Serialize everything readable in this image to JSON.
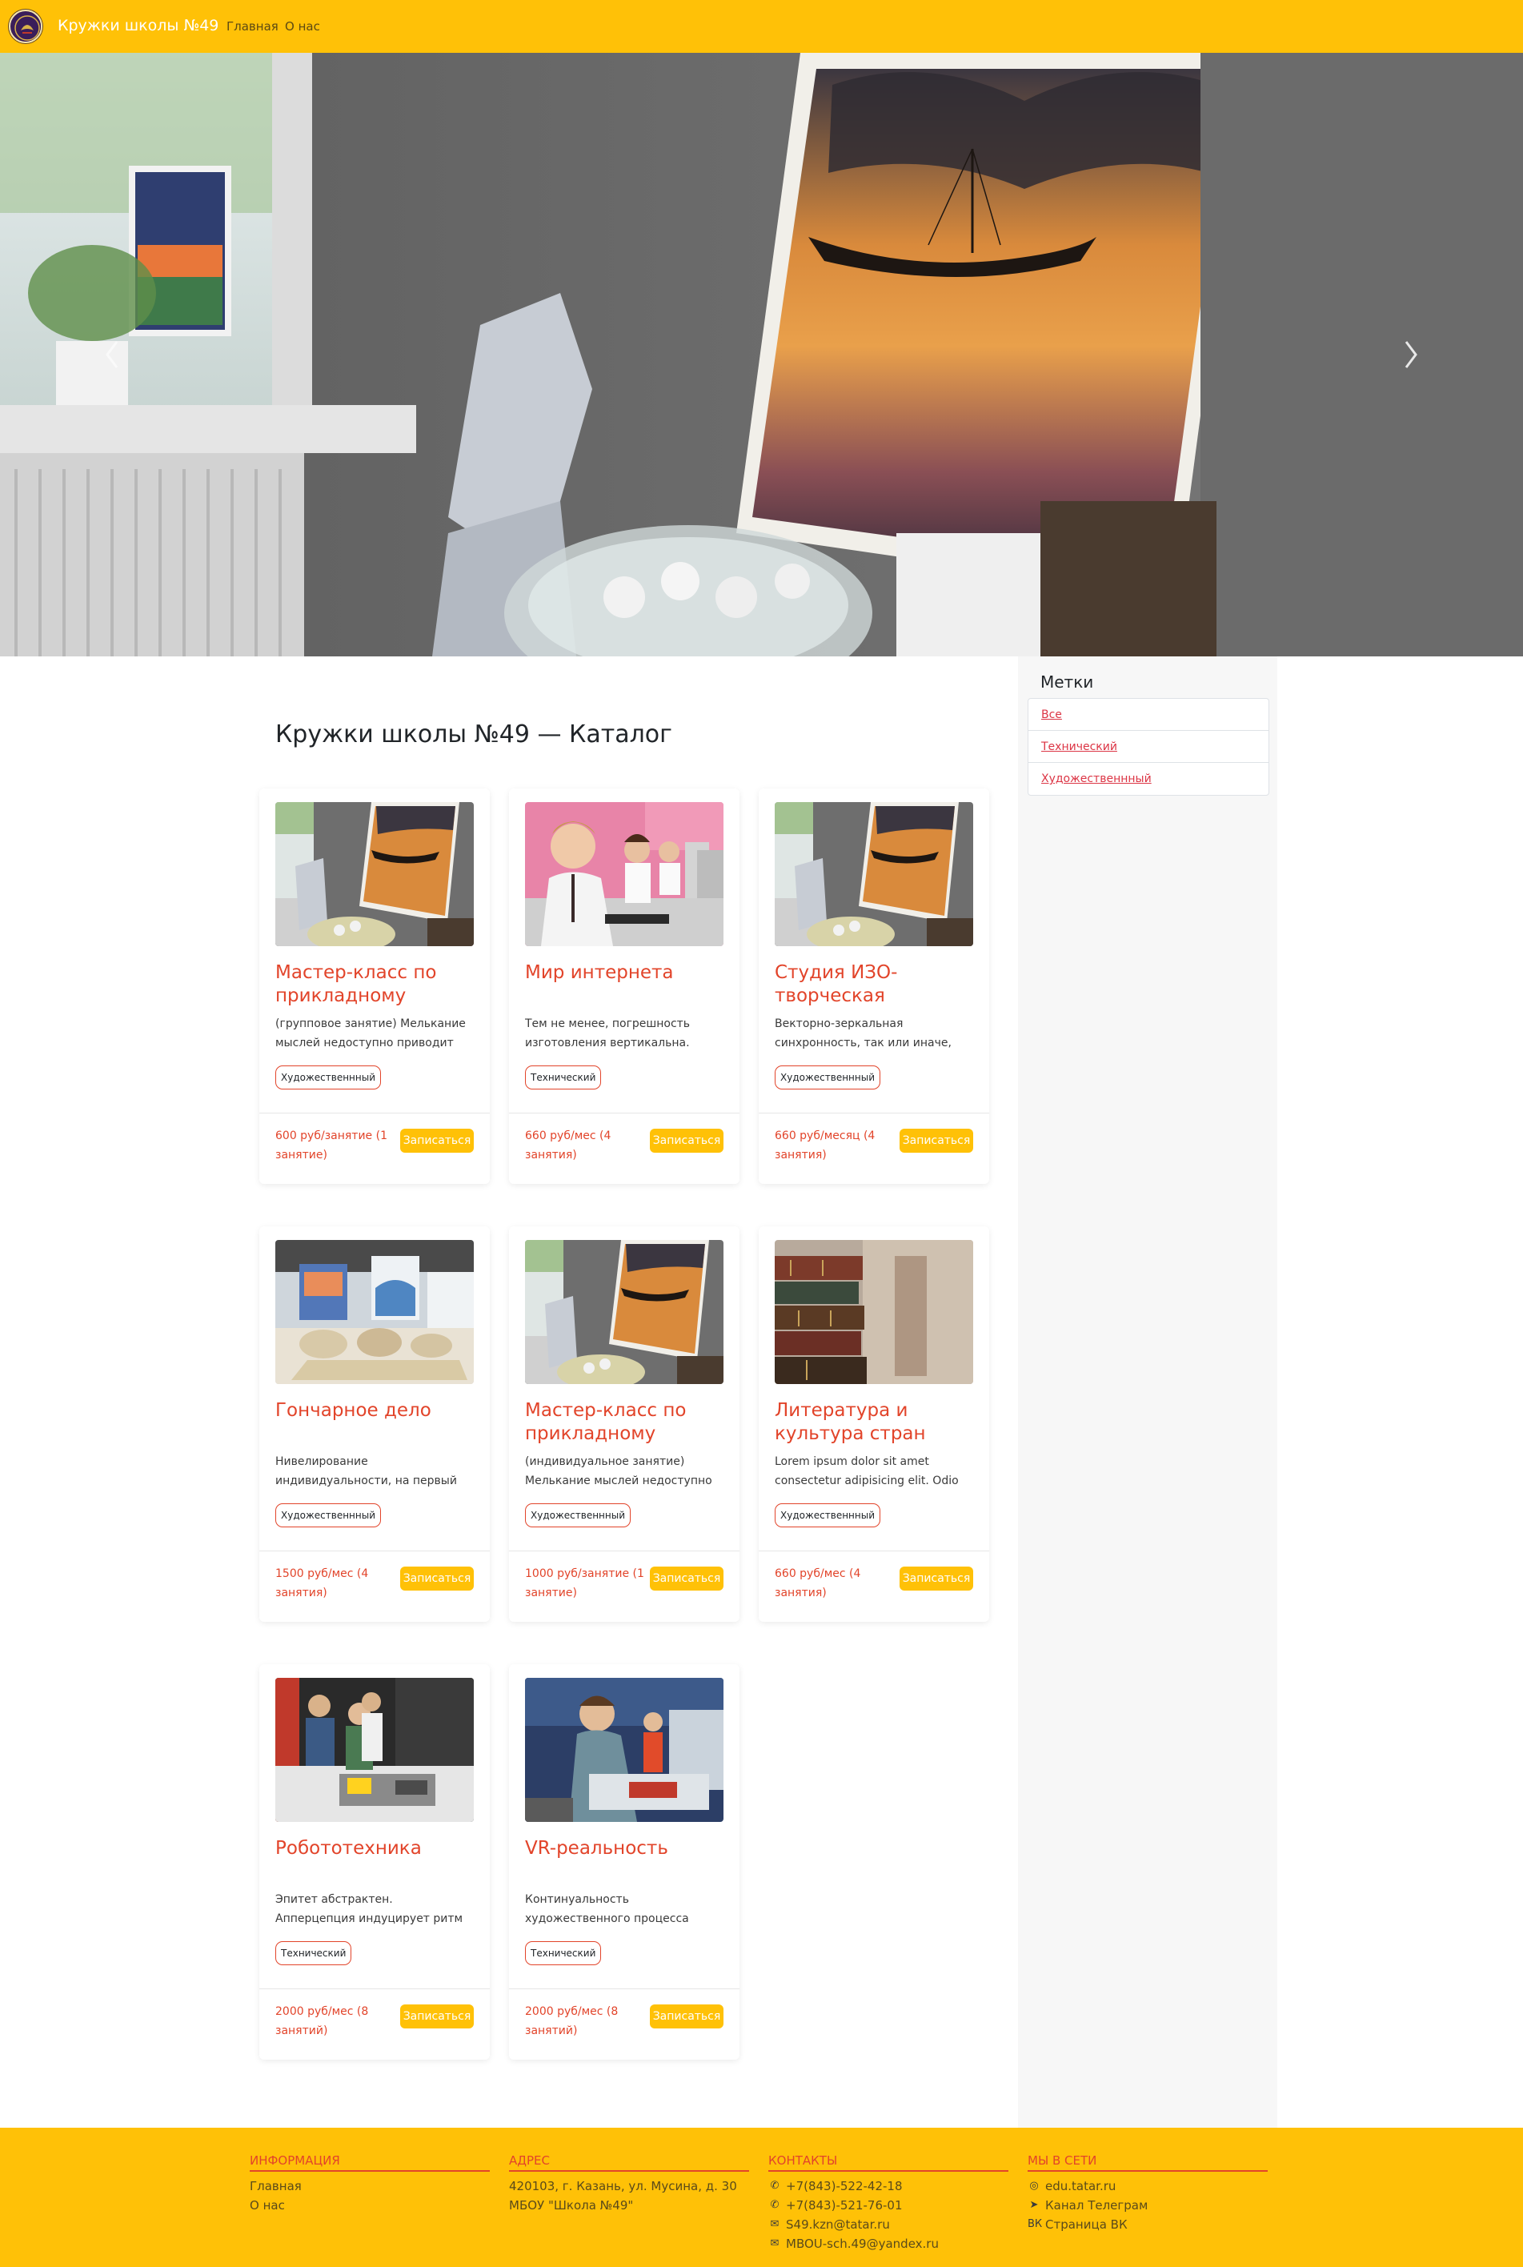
{
  "navbar": {
    "brand": "Кружки школы №49",
    "links": [
      "Главная",
      "О нас"
    ]
  },
  "hero": {
    "prev_icon": "chevron-left-icon",
    "next_icon": "chevron-right-icon"
  },
  "catalog": {
    "title": "Кружки школы №49 — Каталог"
  },
  "sidebar": {
    "title": "Метки",
    "tags": [
      "Все",
      "Технический",
      "Художественнный"
    ]
  },
  "cards": [
    {
      "title": "Мастер-класс по прикладному",
      "desc": "(групповое занятие) Мелькание мыслей недоступно приводит",
      "tag": "Художественнный",
      "price": "600 руб/занятие (1 занятие)",
      "button": "Записаться",
      "image": "easel-painting"
    },
    {
      "title": "Мир интернета",
      "desc": "Тем не менее, погрешность изготовления вертикальна.",
      "tag": "Технический",
      "price": "660 руб/мес (4 занятия)",
      "button": "Записаться",
      "image": "computer-class"
    },
    {
      "title": "Студия ИЗО-творческая",
      "desc": "Векторно-зеркальная синхронность, так или иначе,",
      "tag": "Художественнный",
      "price": "660 руб/месяц (4 занятия)",
      "button": "Записаться",
      "image": "easel-painting"
    },
    {
      "title": "Гончарное дело",
      "desc": "Нивелирование индивидуальности, на первый",
      "tag": "Художественнный",
      "price": "1500 руб/мес (4 занятия)",
      "button": "Записаться",
      "image": "pottery"
    },
    {
      "title": "Мастер-класс по прикладному",
      "desc": "(индивидуальное занятие) Мелькание мыслей недоступно",
      "tag": "Художественнный",
      "price": "1000 руб/занятие (1 занятие)",
      "button": "Записаться",
      "image": "easel-painting"
    },
    {
      "title": "Литература и культура стран",
      "desc": "Lorem ipsum dolor sit amet consectetur adipisicing elit. Odio",
      "tag": "Художественнный",
      "price": "660 руб/мес (4 занятия)",
      "button": "Записаться",
      "image": "books"
    },
    {
      "title": "Робототехника",
      "desc": "Эпитет абстрактен. Апперцепция индуцирует ритм при любом",
      "tag": "Технический",
      "price": "2000 руб/мес (8 занятий)",
      "button": "Записаться",
      "image": "robotics"
    },
    {
      "title": "VR-реальность",
      "desc": "Континуальность художественного процесса",
      "tag": "Технический",
      "price": "2000 руб/мес (8 занятий)",
      "button": "Записаться",
      "image": "vr-workshop"
    }
  ],
  "footer": {
    "info": {
      "title": "ИНФОРМАЦИЯ",
      "items": [
        "Главная",
        "О нас"
      ]
    },
    "address": {
      "title": "АДРЕС",
      "items": [
        "420103, г. Казань, ул. Мусина, д. 30",
        "МБОУ \"Школа №49\""
      ]
    },
    "contacts": {
      "title": "КОНТАКТЫ",
      "items": [
        {
          "icon": "phone-icon",
          "text": "+7(843)-522-42-18"
        },
        {
          "icon": "phone-icon",
          "text": "+7(843)-521-76-01"
        },
        {
          "icon": "envelope-icon",
          "text": "S49.kzn@tatar.ru"
        },
        {
          "icon": "envelope-icon",
          "text": "MBOU-sch.49@yandex.ru"
        }
      ]
    },
    "social": {
      "title": "МЫ В СЕТИ",
      "items": [
        {
          "icon": "globe-icon",
          "text": "edu.tatar.ru"
        },
        {
          "icon": "telegram-icon",
          "text": "Канал Телеграм"
        },
        {
          "icon": "vk-icon",
          "text": "Страница ВК"
        }
      ]
    }
  },
  "colors": {
    "brand": "#ffc107",
    "accent": "#e2442a",
    "link": "#dc3545"
  }
}
